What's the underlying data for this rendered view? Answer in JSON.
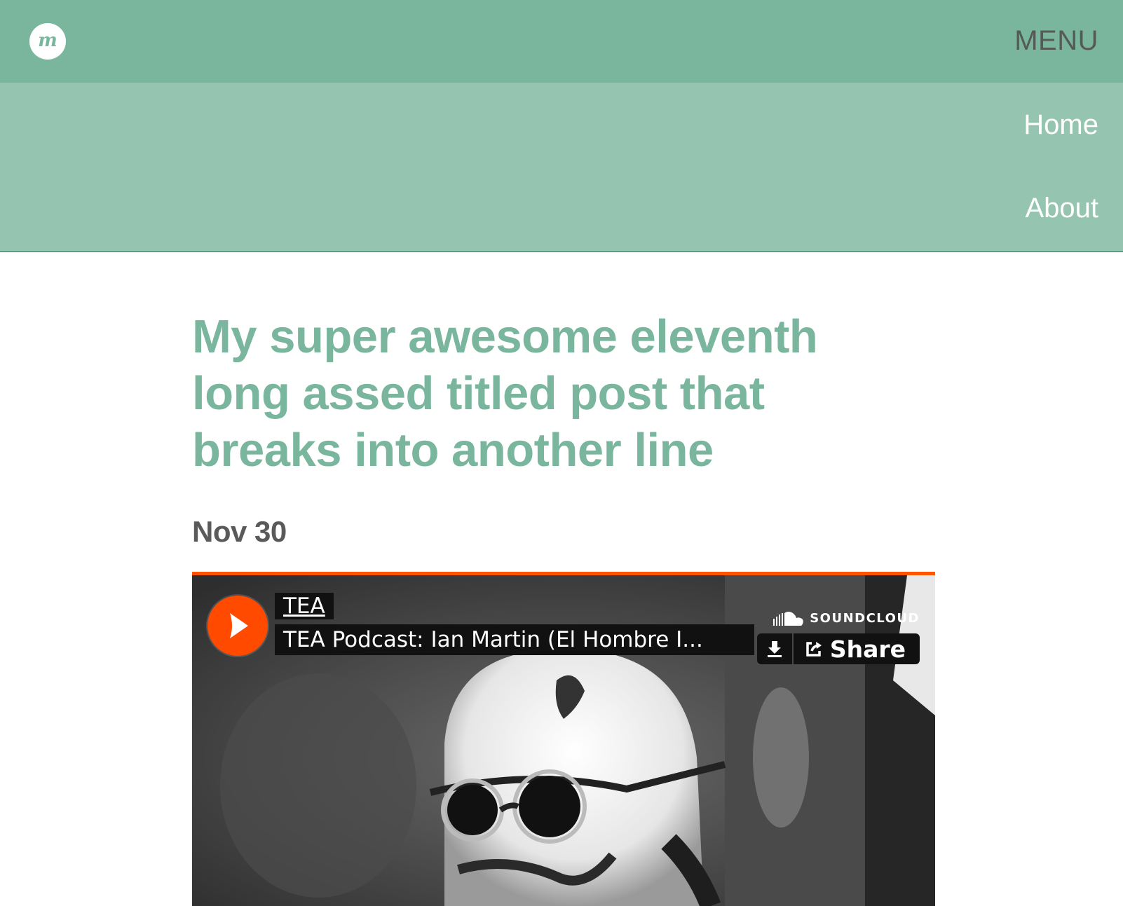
{
  "header": {
    "logo_letter": "m",
    "menu_label": "MENU"
  },
  "nav": {
    "items": [
      {
        "label": "Home"
      },
      {
        "label": "About"
      }
    ]
  },
  "post": {
    "title": "My super awesome eleventh long assed titled post that breaks into another line",
    "date": "Nov 30"
  },
  "soundcloud": {
    "user": "TEA",
    "track_title": "TEA Podcast: Ian Martin (El Hombre I...",
    "brand": "SOUNDCLOUD",
    "share_label": "Share",
    "accent_color": "#ff5500"
  },
  "colors": {
    "brand_green": "#79b69d",
    "dropdown_green": "#95c5b0"
  }
}
